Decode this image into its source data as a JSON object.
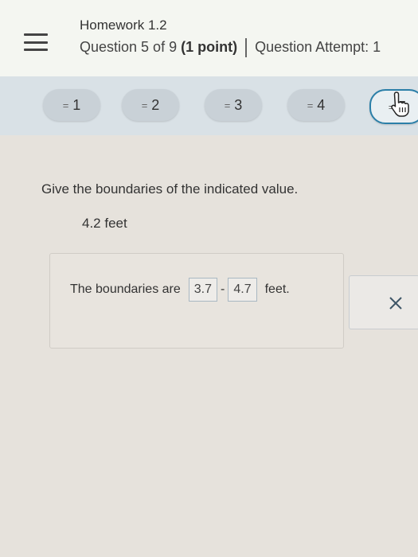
{
  "header": {
    "homework_title": "Homework 1.2",
    "question_prefix": "Question 5 of 9 ",
    "question_points": "(1 point)",
    "attempt_text": "Question Attempt: 1"
  },
  "question_nav": {
    "items": [
      {
        "label": "1",
        "current": false
      },
      {
        "label": "2",
        "current": false
      },
      {
        "label": "3",
        "current": false
      },
      {
        "label": "4",
        "current": false
      },
      {
        "label": "5",
        "current": true
      }
    ]
  },
  "question": {
    "prompt": "Give the boundaries of the indicated value.",
    "value": "4.2 feet"
  },
  "answer": {
    "prefix": "The boundaries are",
    "lower": "3.7",
    "separator": "-",
    "upper": "4.7",
    "suffix": "feet."
  },
  "icons": {
    "menu": "hamburger-menu-icon",
    "list": "list-icon",
    "cursor": "hand-pointer-icon",
    "close": "close-icon"
  },
  "colors": {
    "current_question_border": "#2b7fa8",
    "answer_field_border": "#a9b8c2"
  }
}
